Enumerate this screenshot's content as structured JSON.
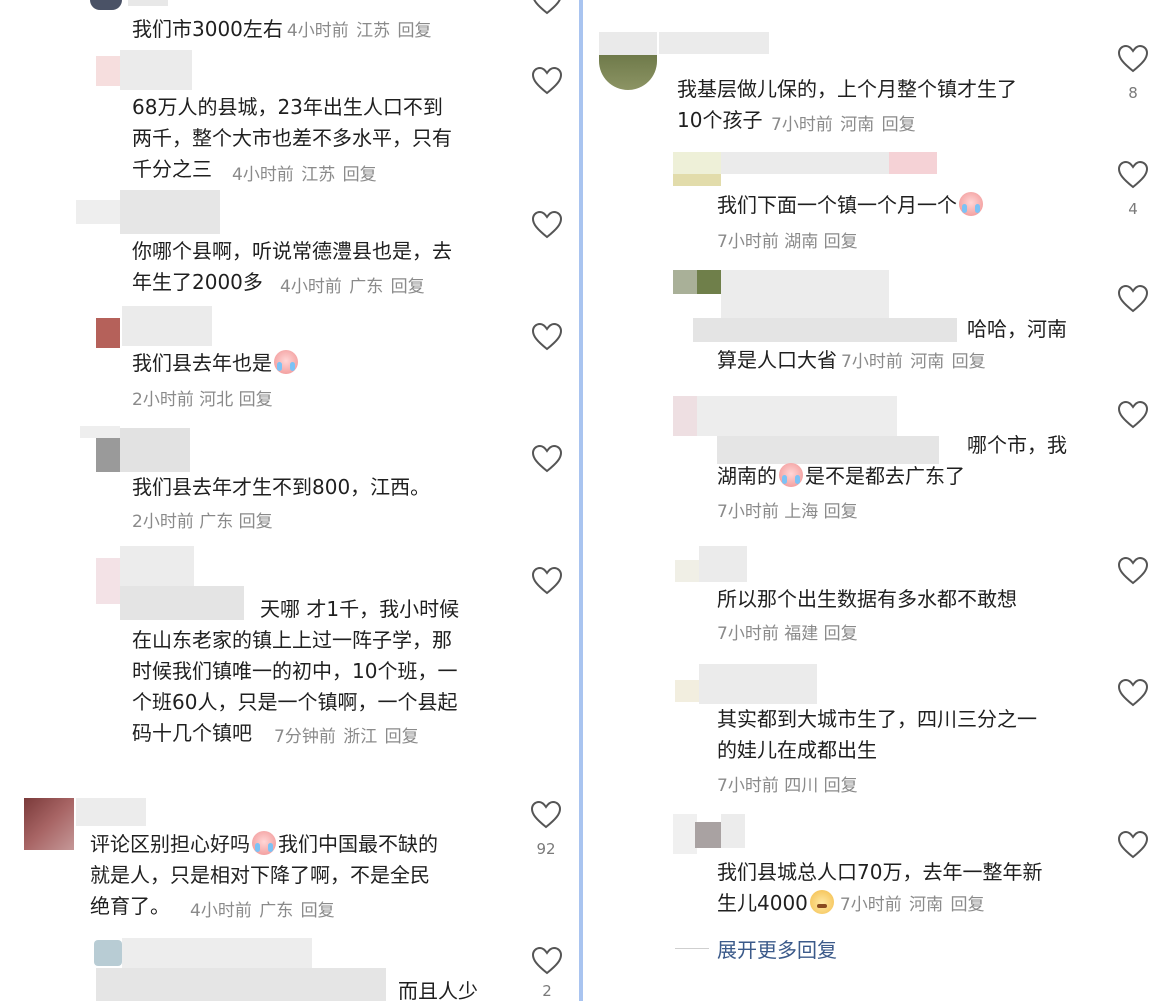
{
  "left_comments": [
    {
      "text": "我们市3000左右",
      "time": "4小时前",
      "location": "江苏",
      "reply": "回复"
    },
    {
      "text": "68万人的县城，23年出生人口不到\n两千，整个大市也差不多水平，只有\n千分之三",
      "time": "4小时前",
      "location": "江苏",
      "reply": "回复"
    },
    {
      "text": "你哪个县啊，听说常德澧县也是，去\n年生了2000多",
      "time": "4小时前",
      "location": "广东",
      "reply": "回复"
    },
    {
      "text": "我们县去年也是",
      "time": "2小时前",
      "location": "河北",
      "reply": "回复"
    },
    {
      "text": "我们县去年才生不到800，江西。",
      "time": "2小时前",
      "location": "广东",
      "reply": "回复"
    },
    {
      "text": "天哪  才1千，我小时候\n在山东老家的镇上上过一阵子学，那\n时候我们镇唯一的初中，10个班，一\n个班60人，只是一个镇啊，一个县起\n码十几个镇吧",
      "time": "7分钟前",
      "location": "浙江",
      "reply": "回复"
    },
    {
      "text_before": "评论区别担心好吗",
      "text_after": "我们中国最不缺的\n就是人，只是相对下降了啊，不是全民\n绝育了。",
      "time": "4小时前",
      "location": "广东",
      "reply": "回复",
      "likes": "92"
    },
    {
      "text": "而且人少",
      "likes": "2"
    }
  ],
  "right_comments": [
    {
      "text": "我基层做儿保的，上个月整个镇才生了\n10个孩子",
      "time": "7小时前",
      "location": "河南",
      "reply": "回复",
      "likes": "8"
    },
    {
      "text": "我们下面一个镇一个月一个",
      "time": "7小时前",
      "location": "湖南",
      "reply": "回复",
      "likes": "4"
    },
    {
      "text_line1": "哈哈，河南",
      "text_line2": "算是人口大省",
      "time": "7小时前",
      "location": "河南",
      "reply": "回复"
    },
    {
      "text_line1": "哪个市，我",
      "text_line2a": "湖南的",
      "text_line2b": "是不是都去广东了",
      "time": "7小时前",
      "location": "上海",
      "reply": "回复"
    },
    {
      "text": "所以那个出生数据有多水都不敢想",
      "time": "7小时前",
      "location": "福建",
      "reply": "回复"
    },
    {
      "text": "其实都到大城市生了，四川三分之一\n的娃儿在成都出生",
      "time": "7小时前",
      "location": "四川",
      "reply": "回复"
    },
    {
      "text_before": "我们县城总人口70万，去年一整年新\n生儿4000",
      "time": "7小时前",
      "location": "河南",
      "reply": "回复"
    }
  ],
  "expand_more": "展开更多回复",
  "colors": {
    "divider": "#a9c4f0",
    "meta_gray": "#8a8a8a",
    "link_blue": "#3b5a8a"
  },
  "icons": [
    "heart-outline-icon",
    "crying-face-emoji",
    "sly-smile-emoji"
  ]
}
